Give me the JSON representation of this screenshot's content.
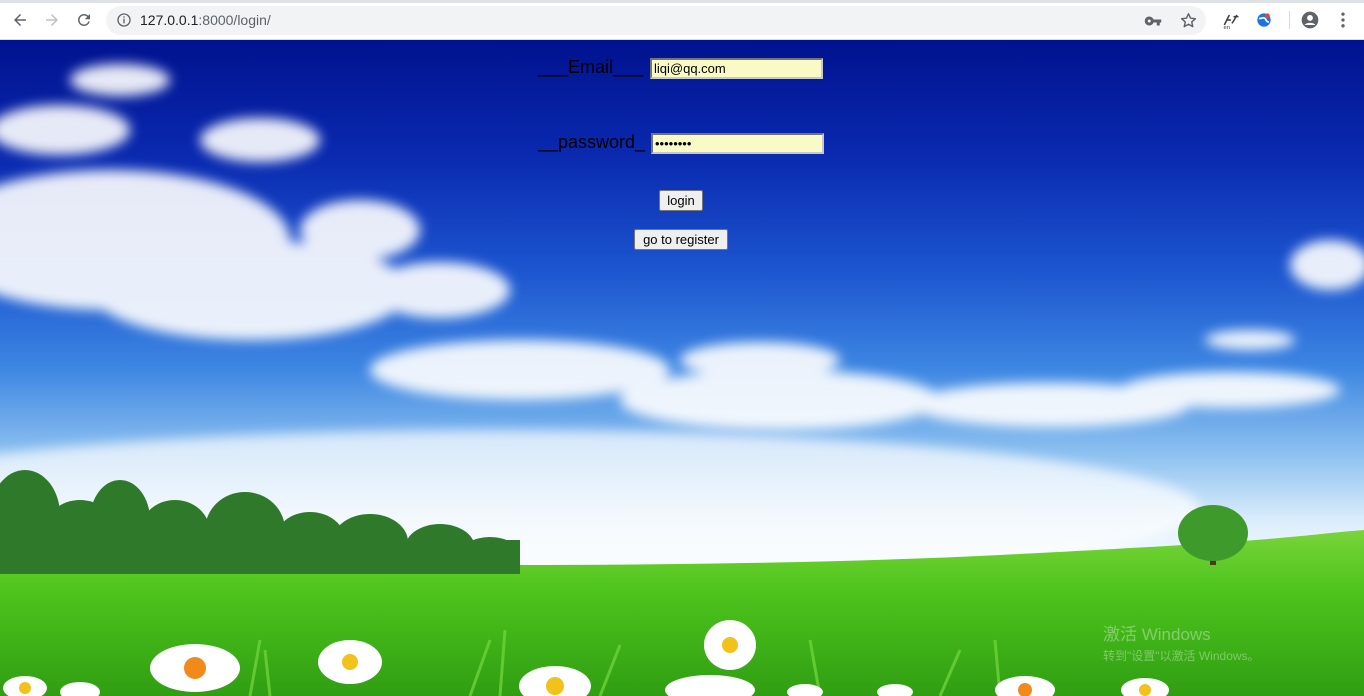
{
  "browser": {
    "url_host": "127.0.0.1",
    "url_rest": ":8000/login/",
    "icons": {
      "back": "arrow-left-icon",
      "forward": "arrow-right-icon",
      "reload": "reload-icon",
      "info": "info-icon",
      "key": "key-icon",
      "bookmark": "star-icon",
      "translate": "translate-extension-icon",
      "extension": "globe-extension-icon",
      "profile": "profile-icon",
      "menu": "kebab-menu-icon"
    }
  },
  "login_form": {
    "email_label": "___Email___",
    "email_value": "liqi@qq.com",
    "password_label": "__password_",
    "password_value": "••••••••",
    "login_button": "login",
    "register_button": "go to register"
  },
  "watermark": {
    "line1": "激活 Windows",
    "line2": "转到\"设置\"以激活 Windows。"
  },
  "colors": {
    "input_bg": "#fafac7",
    "sky_top": "#00128f",
    "grass": "#4fc51d"
  }
}
